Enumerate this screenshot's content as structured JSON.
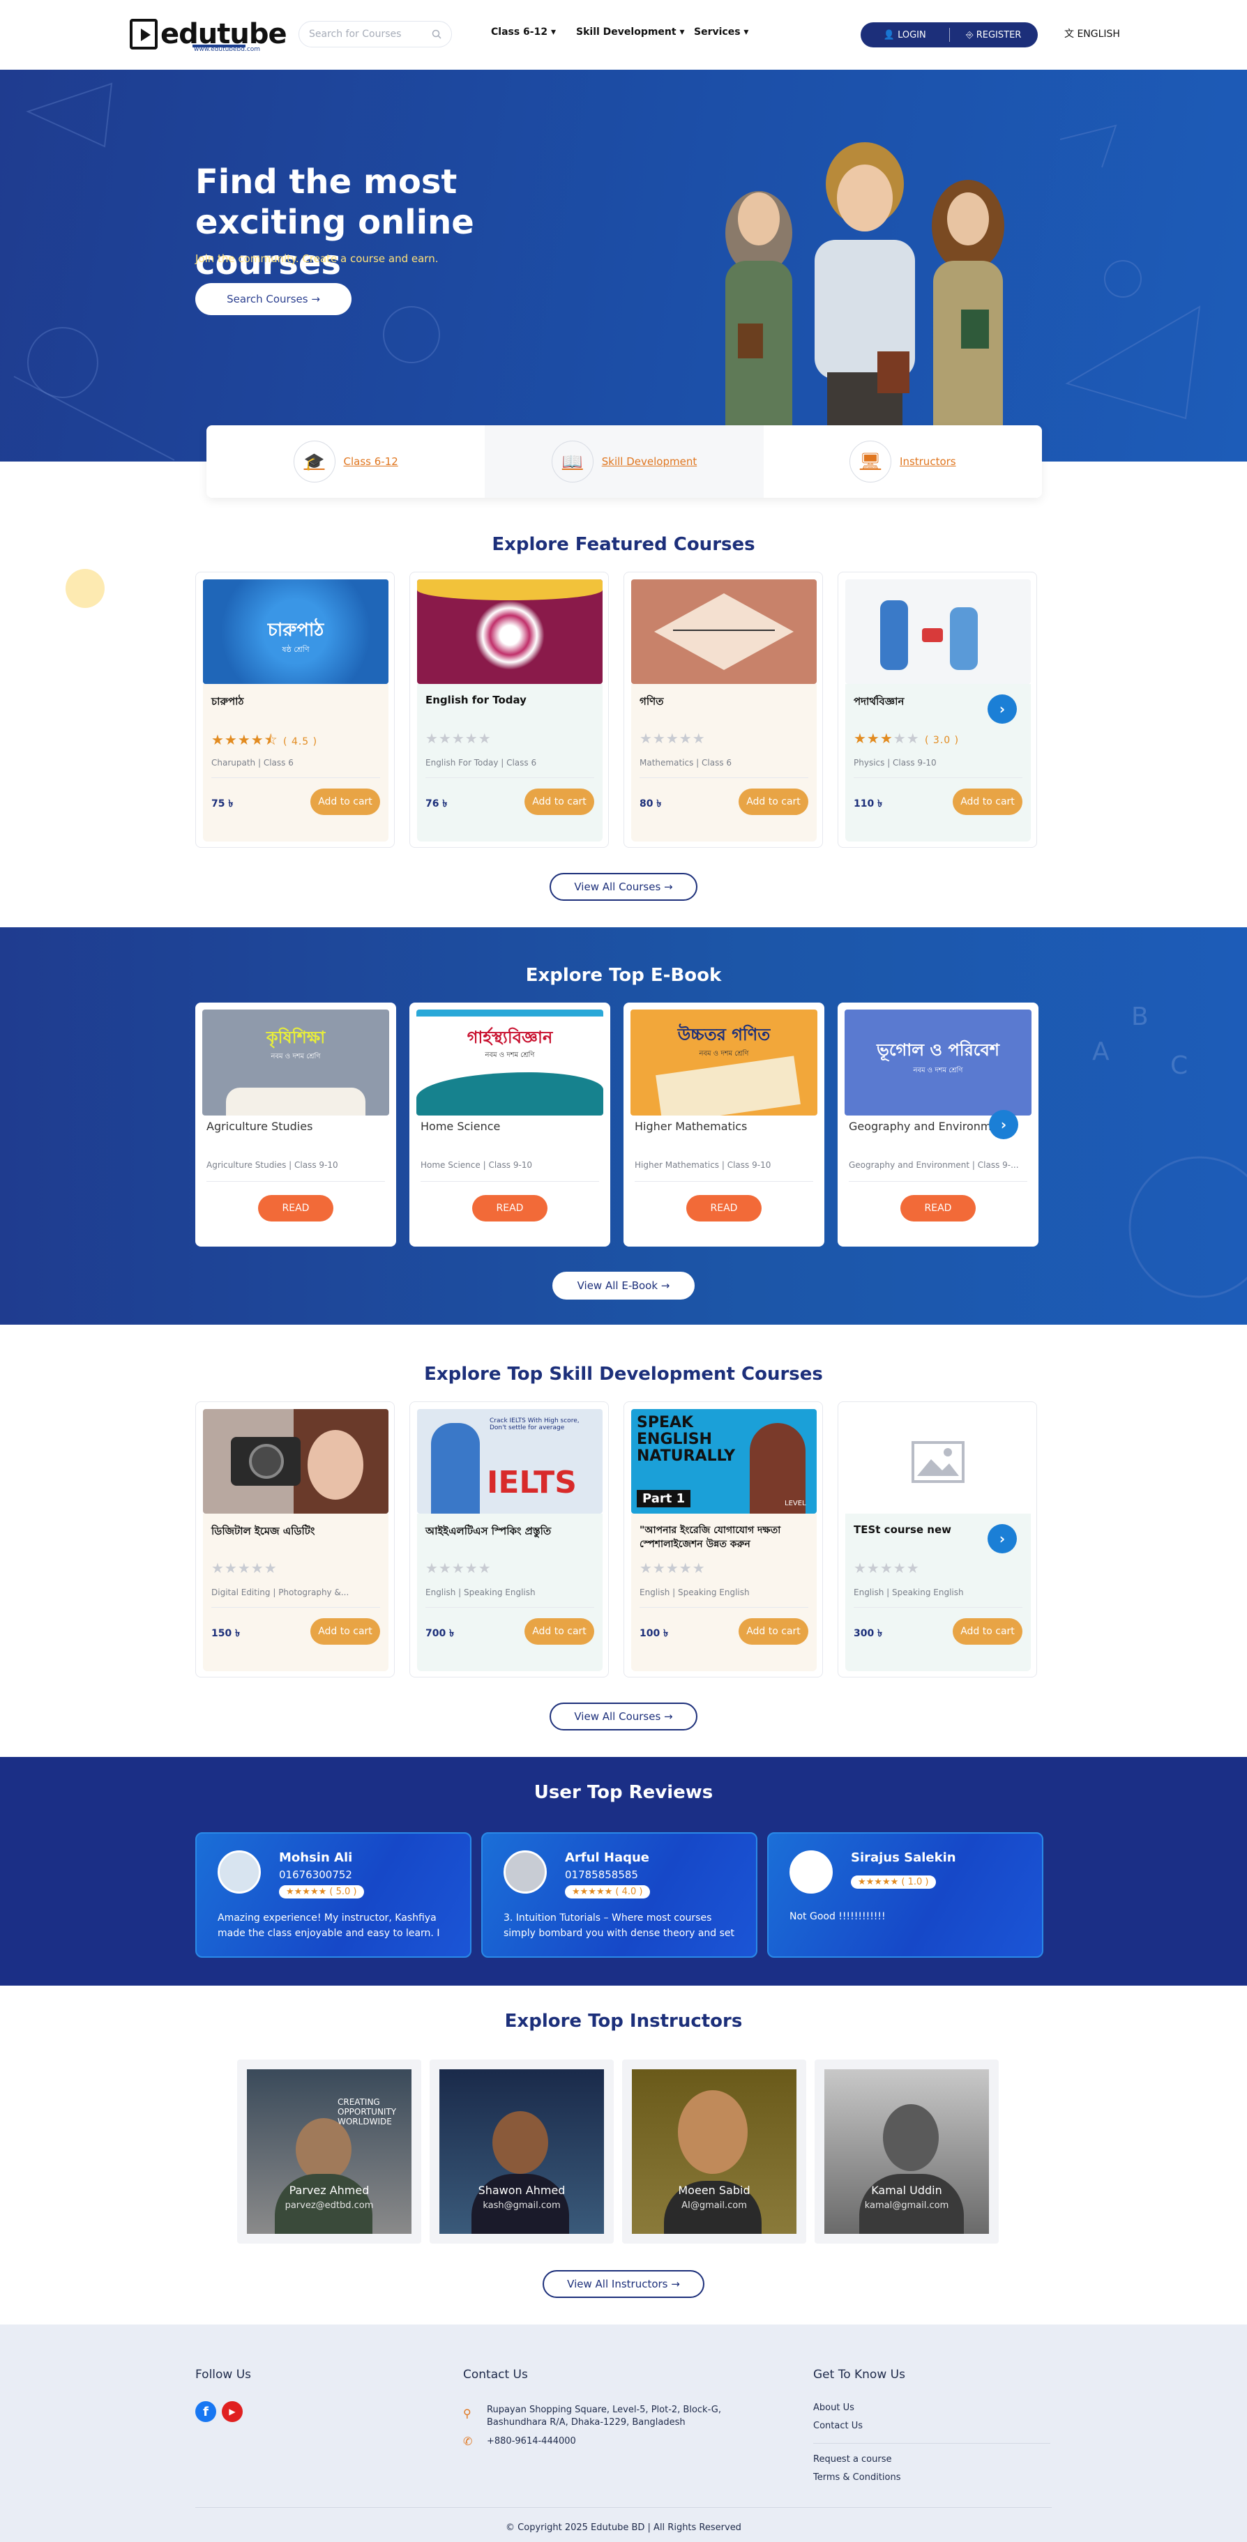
{
  "header": {
    "logo_text": "edutube",
    "logo_sub": "www.edutubebd.com",
    "search_placeholder": "Search for Courses",
    "nav": [
      "Class 6-12 ▾",
      "Skill Development ▾",
      "Services ▾"
    ],
    "login": "LOGIN",
    "register": "REGISTER",
    "language": "ENGLISH"
  },
  "hero": {
    "title": "Find the most exciting online courses",
    "tagline": "Join the community. Create a course and earn.",
    "search_button": "Search Courses →"
  },
  "categories": [
    {
      "label": "Class 6-12",
      "icon": "graduation-cap-icon"
    },
    {
      "label": "Skill Development",
      "icon": "book-icon"
    },
    {
      "label": "Instructors",
      "icon": "monitor-icon"
    }
  ],
  "featured": {
    "title": "Explore Featured Courses",
    "courses": [
      {
        "title": "চারুপাঠ",
        "stars": 4.5,
        "rating_text": "( 4.5 )",
        "meta": "Charupath | Class 6",
        "price": "75 ৳",
        "cart": "Add to cart",
        "bg": "#fbf6ee"
      },
      {
        "title": "English for Today",
        "stars": 0,
        "rating_text": "",
        "meta": "English For Today | Class 6",
        "price": "76 ৳",
        "cart": "Add to cart",
        "bg": "#f0f7f5"
      },
      {
        "title": "গণিত",
        "stars": 0,
        "rating_text": "",
        "meta": "Mathematics | Class 6",
        "price": "80 ৳",
        "cart": "Add to cart",
        "bg": "#fbf6ee"
      },
      {
        "title": "পদার্থবিজ্ঞান",
        "stars": 3,
        "rating_text": "( 3.0 )",
        "meta": "Physics | Class 9-10",
        "price": "110 ৳",
        "cart": "Add to cart",
        "bg": "#f0f7f5"
      }
    ],
    "view_all": "View All Courses →"
  },
  "ebooks": {
    "title": "Explore Top E-Book",
    "items": [
      {
        "title": "Agriculture Studies",
        "cover": "কৃষিশিক্ষা",
        "cover_sub": "নবম ও দশম শ্রেণি",
        "meta": "Agriculture Studies | Class 9-10",
        "read": "READ"
      },
      {
        "title": "Home Science",
        "cover": "গার্হস্থ্যবিজ্ঞান",
        "cover_sub": "নবম ও দশম শ্রেণি",
        "meta": "Home Science | Class 9-10",
        "read": "READ"
      },
      {
        "title": "Higher Mathematics",
        "cover": "উচ্চতর গণিত",
        "cover_sub": "নবম ও দশম শ্রেণি",
        "meta": "Higher Mathematics | Class 9-10",
        "read": "READ"
      },
      {
        "title": "Geography and Environment",
        "cover": "ভূগোল ও পরিবেশ",
        "cover_sub": "নবম ও দশম শ্রেণি",
        "meta": "Geography and Environment | Class 9-...",
        "read": "READ"
      }
    ],
    "view_all": "View All E-Book →"
  },
  "skills": {
    "title": "Explore Top Skill Development Courses",
    "courses": [
      {
        "title": "ডিজিটাল ইমেজ এডিটিং",
        "meta": "Digital Editing | Photography &...",
        "price": "150 ৳",
        "cart": "Add to cart",
        "bg": "#fbf6ee"
      },
      {
        "title": "আইইএলটিএস স্পিকিং প্রস্তুতি",
        "meta": "English | Speaking English",
        "price": "700 ৳",
        "cart": "Add to cart",
        "bg": "#f0f7f5"
      },
      {
        "title": "\"আপনার ইংরেজি যোগাযোগ দক্ষতা স্পেশালাইজেশন উন্নত করুন",
        "meta": "English | Speaking English",
        "price": "100 ৳",
        "cart": "Add to cart",
        "bg": "#fbf6ee"
      },
      {
        "title": "TESt course new",
        "meta": "English | Speaking English",
        "price": "300 ৳",
        "cart": "Add to cart",
        "bg": "#f0f7f5"
      }
    ],
    "ielts_text": "IELTS",
    "ielts_note": "Crack IELTS With High score, Don't settle for average",
    "speak_text": "SPEAK ENGLISH NATURALLY",
    "speak_part": "Part 1",
    "speak_level": "LEVEL",
    "view_all": "View All Courses →"
  },
  "reviews": {
    "title": "User Top Reviews",
    "items": [
      {
        "name": "Mohsin Ali",
        "phone": "01676300752",
        "stars": "★★★★★",
        "rating": "( 5.0 )",
        "text": "Amazing experience! My instructor, Kashfiya made the class enjoyable and easy to learn. I"
      },
      {
        "name": "Arful Haque",
        "phone": "01785858585",
        "stars": "★★★★★",
        "rating": "( 4.0 )",
        "text": "3. Intuition Tutorials – Where most courses simply bombard you with dense theory and set"
      },
      {
        "name": "Sirajus Salekin",
        "phone": "",
        "stars": "★★★★★",
        "rating": "( 1.0 )",
        "text": "Not Good !!!!!!!!!!!!"
      }
    ]
  },
  "instructors": {
    "title": "Explore Top Instructors",
    "items": [
      {
        "name": "Parvez Ahmed",
        "email": "parvez@edtbd.com",
        "bg_note": "CREATING OPPORTUNITY WORLDWIDE"
      },
      {
        "name": "Shawon Ahmed",
        "email": "kash@gmail.com"
      },
      {
        "name": "Moeen Sabid",
        "email": "AI@gmail.com"
      },
      {
        "name": "Kamal Uddin",
        "email": "kamal@gmail.com"
      }
    ],
    "view_all": "View All Instructors →"
  },
  "footer": {
    "follow": "Follow Us",
    "contact_title": "Contact Us",
    "address": "Rupayan Shopping Square, Level-5, Plot-2, Block-G, Bashundhara R/A, Dhaka-1229, Bangladesh",
    "phone": "+880-9614-444000",
    "know_title": "Get To Know Us",
    "links1": [
      "About Us",
      "Contact Us"
    ],
    "links2": [
      "Request a course",
      "Terms & Conditions"
    ],
    "copyright": "© Copyright 2025 Edutube BD | All Rights Reserved"
  },
  "colors": {
    "brand": "#1c2f7a",
    "accent": "#e8a445",
    "read": "#f26a38",
    "link": "#e0761f"
  }
}
